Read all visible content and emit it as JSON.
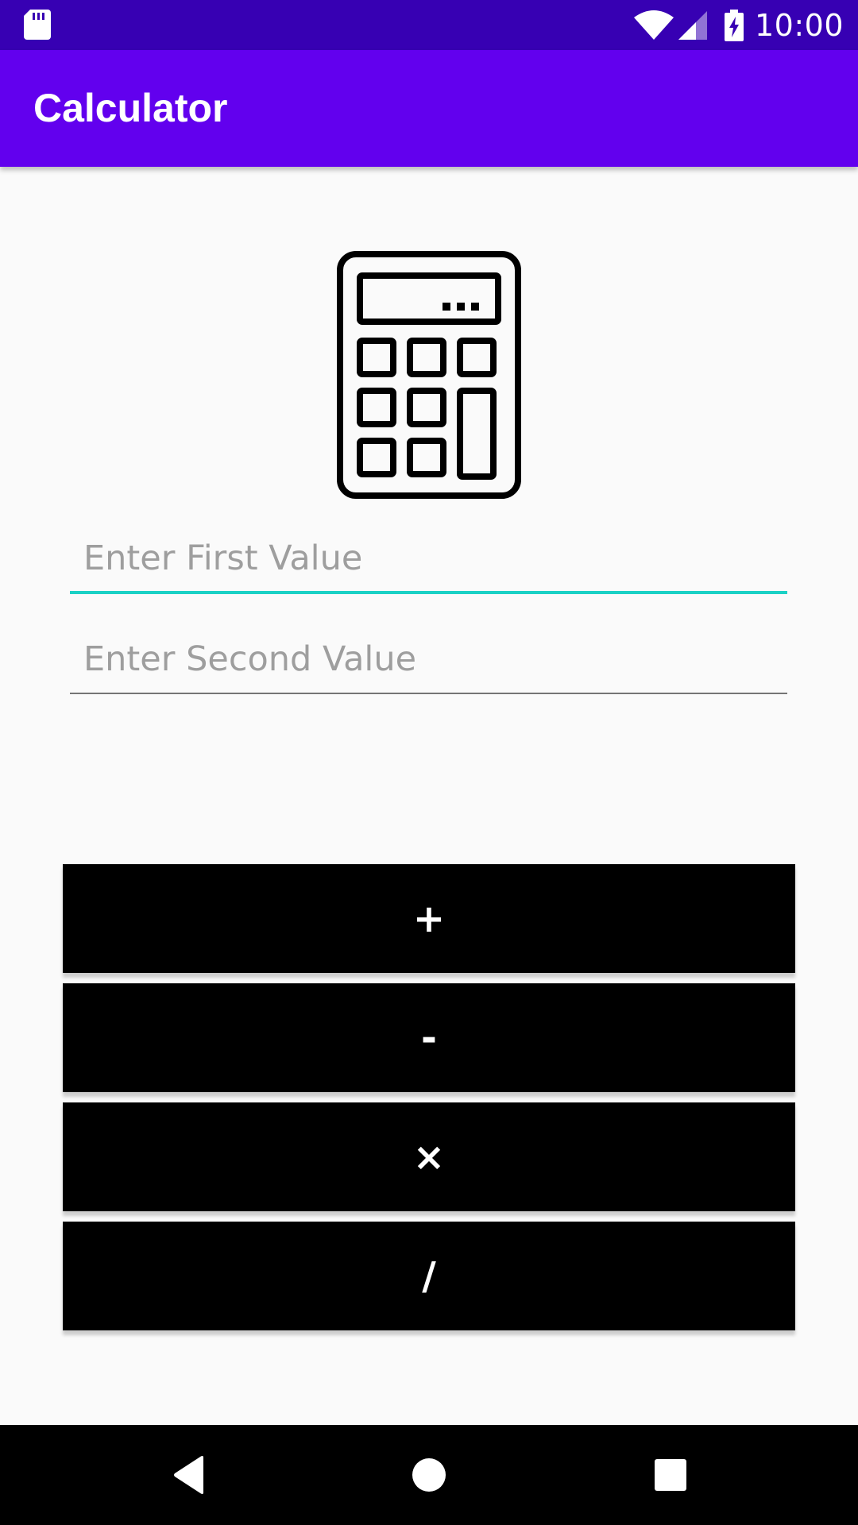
{
  "status_bar": {
    "time": "10:00",
    "icons": [
      "sd-card-icon",
      "wifi-icon",
      "signal-icon",
      "battery-charging-icon"
    ],
    "background_color": "#3700b3"
  },
  "app_bar": {
    "title": "Calculator",
    "background_color": "#6200ee"
  },
  "illustration": {
    "icon": "calculator-icon"
  },
  "inputs": {
    "first": {
      "placeholder": "Enter First Value",
      "value": "",
      "focused": true,
      "accent_color": "#1bd1c5"
    },
    "second": {
      "placeholder": "Enter Second Value",
      "value": ""
    }
  },
  "operations": {
    "add": "+",
    "subtract": "-",
    "multiply": "×",
    "divide": "/"
  },
  "nav_bar": {
    "icons": [
      "back-icon",
      "home-icon",
      "recents-icon"
    ]
  }
}
